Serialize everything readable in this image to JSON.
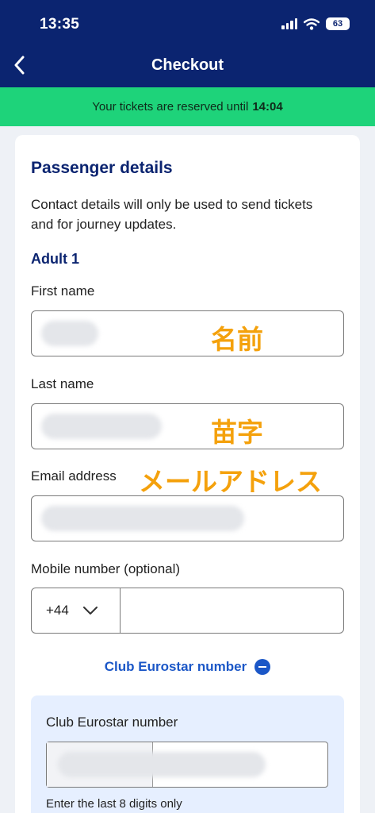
{
  "status_bar": {
    "time": "13:35",
    "battery": "63"
  },
  "header": {
    "title": "Checkout"
  },
  "banner": {
    "text": "Your tickets are reserved until",
    "time": "14:04"
  },
  "form": {
    "section_title": "Passenger details",
    "contact_text": "Contact details will only be used to send tickets and for journey updates.",
    "adult_title": "Adult 1",
    "first_name_label": "First name",
    "first_name_note": "名前",
    "last_name_label": "Last name",
    "last_name_note": "苗字",
    "email_label": "Email address",
    "email_note": "メールアドレス",
    "mobile_label": "Mobile number (optional)",
    "country_code": "+44",
    "club_link": "Club Eurostar number",
    "club_label": "Club Eurostar number",
    "club_hint": "Enter the last 8 digits only"
  },
  "colors": {
    "header": "#0b2470",
    "banner": "#1ed37a",
    "link": "#1b57c7",
    "annotation": "#f4a10c",
    "club_box": "#e6efff"
  }
}
